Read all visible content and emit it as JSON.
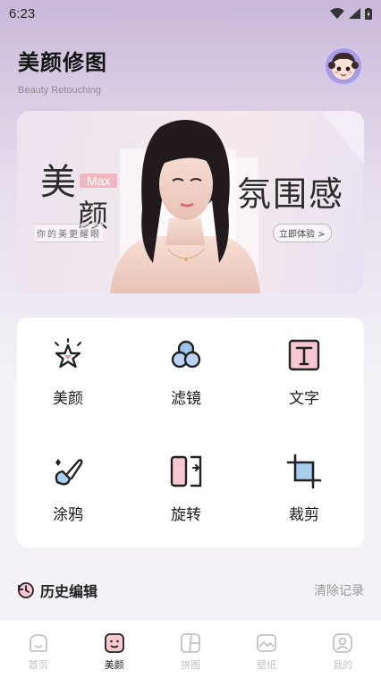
{
  "status": {
    "time": "6:23"
  },
  "header": {
    "title": "美颜修图",
    "subtitle": "Beauty Retouching"
  },
  "banner": {
    "left_char1": "美",
    "left_badge": "Max",
    "left_char2": "颜",
    "left_tagline": "你的美更耀眼",
    "right_text": "氛围感",
    "cta": "立即体验 >"
  },
  "tools": [
    {
      "label": "美颜",
      "icon": "star-sparkle-icon"
    },
    {
      "label": "滤镜",
      "icon": "filter-circles-icon"
    },
    {
      "label": "文字",
      "icon": "text-t-icon"
    },
    {
      "label": "涂鸦",
      "icon": "brush-icon"
    },
    {
      "label": "旋转",
      "icon": "rotate-icon"
    },
    {
      "label": "裁剪",
      "icon": "crop-icon"
    }
  ],
  "history": {
    "title": "历史编辑",
    "clear": "清除记录"
  },
  "nav": [
    {
      "label": "首页",
      "icon": "home-icon"
    },
    {
      "label": "美颜",
      "icon": "beauty-face-icon"
    },
    {
      "label": "拼图",
      "icon": "collage-icon"
    },
    {
      "label": "壁纸",
      "icon": "wallpaper-icon"
    },
    {
      "label": "我的",
      "icon": "profile-icon"
    }
  ],
  "colors": {
    "accent_pink": "#f08fa6",
    "accent_blue": "#7fb3e8",
    "active": "#222222",
    "inactive": "#c2c2c2"
  }
}
